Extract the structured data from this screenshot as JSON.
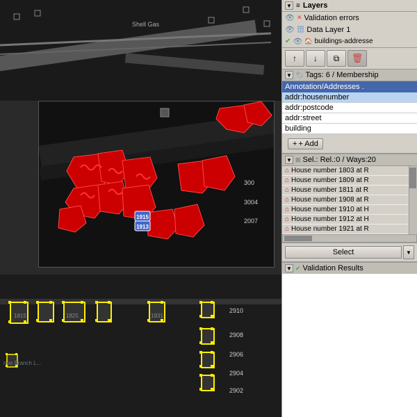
{
  "layers": {
    "title": "Layers",
    "items": [
      {
        "id": "validation-errors",
        "label": "Validation errors",
        "visible": true,
        "icon": "eye",
        "status": "warning"
      },
      {
        "id": "data-layer-1",
        "label": "Data Layer 1",
        "visible": true,
        "icon": "eye",
        "status": "data"
      },
      {
        "id": "buildings-addresses",
        "label": "buildings-addresse",
        "visible": true,
        "icon": "eye",
        "status": "check"
      }
    ]
  },
  "toolbar": {
    "up_label": "↑",
    "down_label": "↓",
    "merge_label": "⧉",
    "delete_label": "🗑"
  },
  "tags": {
    "section_label": "Tags: 6 / Membership",
    "table_header": "Annotation/Addresses .",
    "rows": [
      {
        "key": "addr:housenumber",
        "selected": true
      },
      {
        "key": "addr:postcode",
        "selected": false
      },
      {
        "key": "addr:street",
        "selected": false
      },
      {
        "key": "building",
        "selected": false
      }
    ],
    "add_label": "+ Add"
  },
  "selection": {
    "section_label": "Sel.: Rel.:0 / Ways:20",
    "items": [
      {
        "label": "House number 1803 at R"
      },
      {
        "label": "House number 1809 at R"
      },
      {
        "label": "House number 1811 at R"
      },
      {
        "label": "House number 1908 at R"
      },
      {
        "label": "House number 1910 at H"
      },
      {
        "label": "House number 1912 at H"
      },
      {
        "label": "House number 1921 at R"
      }
    ]
  },
  "select_button": {
    "label": "Select"
  },
  "validation": {
    "label": "Validation Results"
  }
}
